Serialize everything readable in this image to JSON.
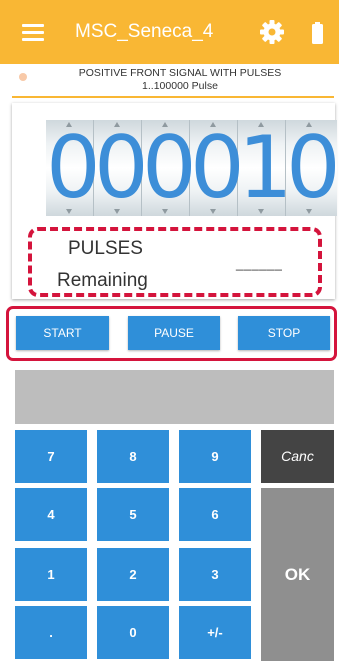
{
  "app_bar": {
    "title": "MSC_Seneca_4",
    "menu_icon": "hamburger-menu-icon",
    "settings_icon": "gear-icon",
    "battery_icon": "battery-icon",
    "background_color": "#f9b734"
  },
  "info": {
    "mode": "POSITIVE FRONT SIGNAL WITH PULSES",
    "range": "1..100000 Pulse"
  },
  "counter": {
    "digits": [
      "0",
      "0",
      "0",
      "0",
      "1",
      "0"
    ],
    "digit_color": "#3d8ed8"
  },
  "pulses": {
    "label": "PULSES",
    "remaining_label": "Remaining",
    "value": "______"
  },
  "actions": {
    "start": "START",
    "pause": "PAUSE",
    "stop": "STOP"
  },
  "display": {
    "value": ""
  },
  "keypad": {
    "keys": [
      "7",
      "8",
      "9",
      "4",
      "5",
      "6",
      "1",
      "2",
      "3",
      ".",
      "0",
      "+/-"
    ],
    "cancel": "Canc",
    "ok": "OK",
    "key_color": "#2f8fd9"
  },
  "highlight_color": "#d4143c"
}
